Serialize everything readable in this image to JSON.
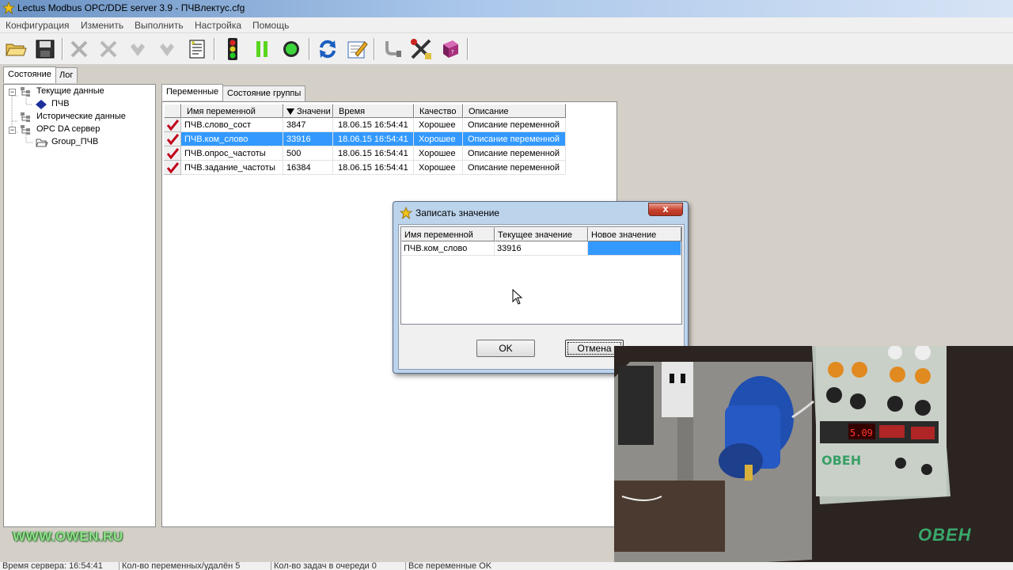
{
  "window": {
    "title": "Lectus Modbus OPC/DDE server 3.9 - ПЧВлектус.cfg"
  },
  "menu": [
    "Конфигурация",
    "Изменить",
    "Выполнить",
    "Настройка",
    "Помощь"
  ],
  "toolbar": {
    "icons": [
      "open-folder-icon",
      "save-icon",
      "delete-icon",
      "delete-all-icon",
      "add-node-icon",
      "add-item-icon",
      "report-icon",
      "traffic-light-icon",
      "pause-icon",
      "run-icon",
      "refresh-icon",
      "edit-icon",
      "connect-icon",
      "tools-icon",
      "help-book-icon"
    ]
  },
  "left_tabs": {
    "state": "Состояние",
    "log": "Лог"
  },
  "tree": {
    "current_data": "Текущие данные",
    "pchv": "ПЧВ",
    "historical": "Исторические данные",
    "opc_server": "OPC DA сервер",
    "group": "Group_ПЧВ"
  },
  "right_tabs": {
    "variables": "Переменные",
    "group_state": "Состояние группы"
  },
  "grid": {
    "headers": {
      "name": "Имя переменной",
      "value": "Значени",
      "time": "Время",
      "quality": "Качество",
      "description": "Описание"
    },
    "rows": [
      {
        "name": "ПЧВ.слово_сост",
        "value": "3847",
        "time": "18.06.15 16:54:41",
        "quality": "Хорошее",
        "description": "Описание переменной"
      },
      {
        "name": "ПЧВ.ком_слово",
        "value": "33916",
        "time": "18.06.15 16:54:41",
        "quality": "Хорошее",
        "description": "Описание переменной"
      },
      {
        "name": "ПЧВ.опрос_частоты",
        "value": "500",
        "time": "18.06.15 16:54:41",
        "quality": "Хорошее",
        "description": "Описание переменной"
      },
      {
        "name": "ПЧВ.задание_частоты",
        "value": "16384",
        "time": "18.06.15 16:54:41",
        "quality": "Хорошее",
        "description": "Описание переменной"
      }
    ]
  },
  "dialog": {
    "title": "Записать значение",
    "close": "x",
    "headers": {
      "name": "Имя переменной",
      "current": "Текущее значение",
      "new": "Новое значение"
    },
    "row": {
      "name": "ПЧВ.ком_слово",
      "current": "33916",
      "new": ""
    },
    "ok": "OK",
    "cancel": "Отмена"
  },
  "watermark": "WWW.OWEN.RU",
  "video_brand": "ОВЕН",
  "statusbar": [
    "Время сервера: 16:54:41",
    "Кол-во переменных/удалён 5",
    "Кол-во задач в очереди 0",
    "Все переменные OK"
  ],
  "colors": {
    "selection": "#3399ff",
    "check": "#c0001a",
    "owen_green": "#3aa86b"
  }
}
